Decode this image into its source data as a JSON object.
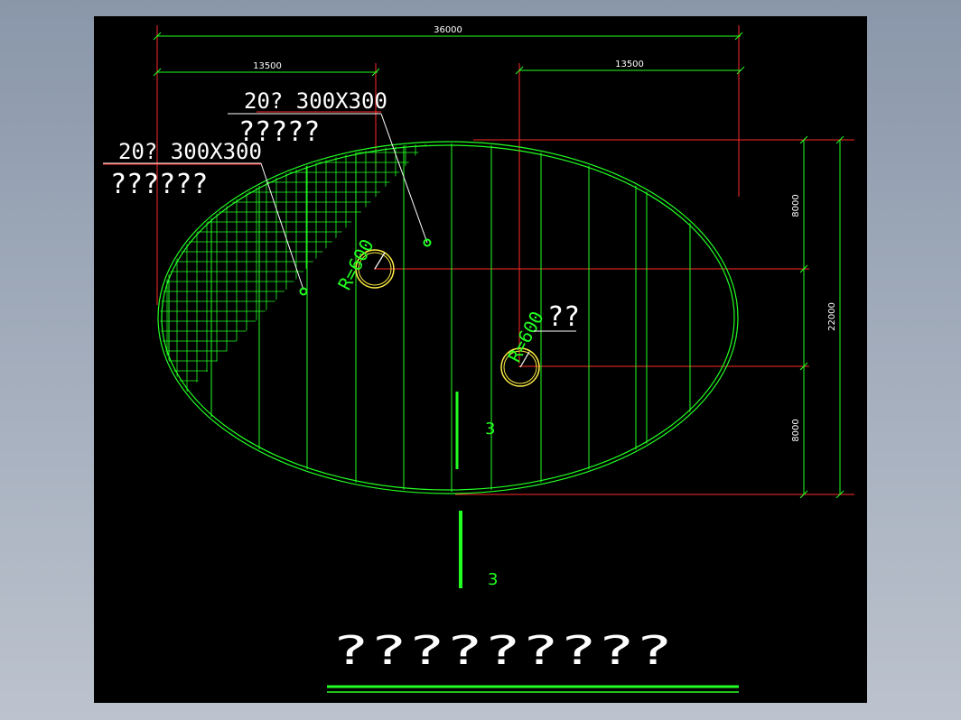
{
  "dimensions": {
    "overall_width": "36000",
    "left_offset": "13500",
    "right_offset": "13500",
    "top_vertical": "8000",
    "bottom_vertical": "8000",
    "overall_height": "22000"
  },
  "notes": {
    "upper_spec": "20? 300X300",
    "upper_desc": "?????",
    "lower_spec": "20? 300X300",
    "lower_desc": "??????",
    "radius_upper": "R=600",
    "radius_lower": "R=600",
    "radius_lower_tag": "??"
  },
  "section_marks": {
    "upper": "3",
    "lower": "3"
  },
  "title": "?????????",
  "colors": {
    "background": "#000000",
    "ellipse": "#22ff22",
    "dimension": "#22ff22",
    "reference_line": "#ff2222",
    "circle": "#ffee44",
    "text": "#ffffff"
  }
}
